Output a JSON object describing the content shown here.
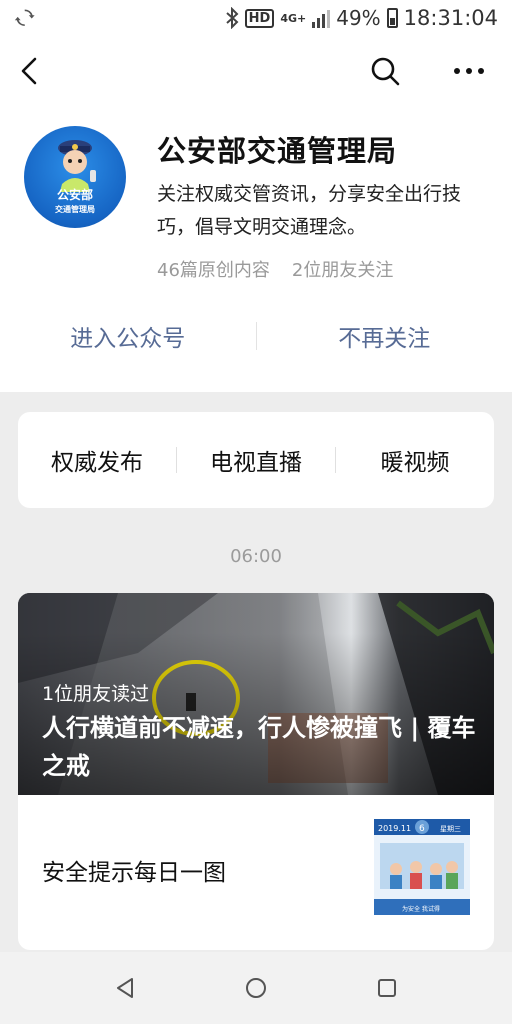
{
  "status_bar": {
    "hd": "HD",
    "network": "4G+",
    "battery": "49%",
    "time": "18:31:04"
  },
  "account": {
    "name": "公安部交通管理局",
    "description": "关注权威交管资讯，分享安全出行技巧，倡导文明交通理念。",
    "original_count": "46篇原创内容",
    "friends_following": "2位朋友关注",
    "avatar_text_main": "公安部",
    "avatar_text_sub": "交通管理局"
  },
  "actions": {
    "enter": "进入公众号",
    "unfollow": "不再关注"
  },
  "menu": [
    {
      "label": "权威发布"
    },
    {
      "label": "电视直播"
    },
    {
      "label": "暖视频"
    }
  ],
  "feed": {
    "timestamp": "06:00",
    "main_article": {
      "friends_read": "1位朋友读过",
      "title": "人行横道前不减速，行人惨被撞飞 | 覆车之戒"
    },
    "sub_article": {
      "title": "安全提示每日一图",
      "thumb_date": "2019.11",
      "thumb_day": "6",
      "thumb_weekday": "星期三",
      "thumb_caption": "为安全 我试得"
    }
  },
  "colors": {
    "link": "#576b95",
    "background": "#ededed",
    "card": "#ffffff"
  }
}
